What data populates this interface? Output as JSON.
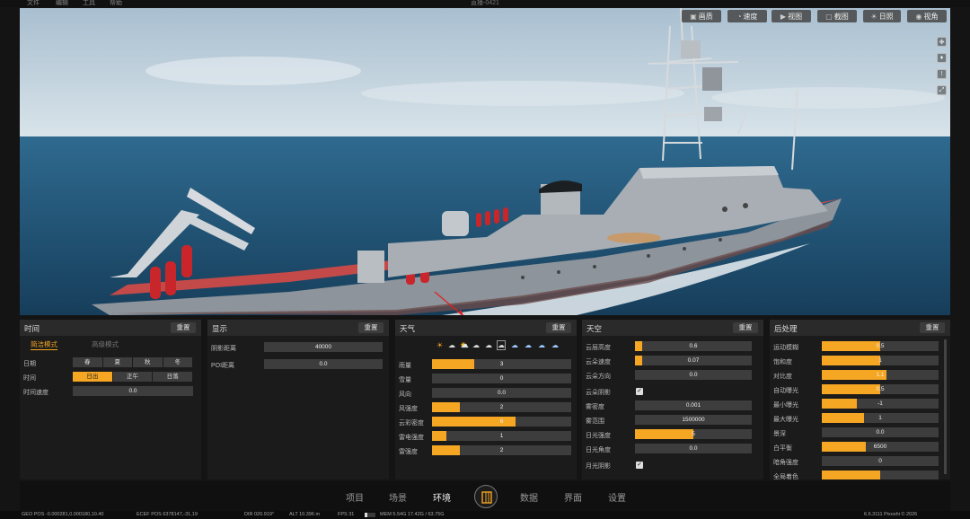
{
  "menubar": {
    "items": [
      "文件",
      "编辑",
      "工具",
      "帮助"
    ],
    "window_title": "直播-0421"
  },
  "viewport": {
    "top_buttons": [
      {
        "icon": "image-icon",
        "label": "画质"
      },
      {
        "icon": "speed-icon",
        "label": "速度"
      },
      {
        "icon": "video-icon",
        "label": "视图"
      },
      {
        "icon": "screenshot-icon",
        "label": "截图"
      },
      {
        "icon": "sun-icon",
        "label": "日照"
      },
      {
        "icon": "eye-icon",
        "label": "视角"
      }
    ],
    "side_icons": [
      "move-icon",
      "walk-icon",
      "info-icon",
      "resize-icon"
    ]
  },
  "panels": {
    "time": {
      "title": "时间",
      "reset": "重置",
      "modes": [
        "简洁模式",
        "高级模式"
      ],
      "rows": [
        {
          "label": "日期",
          "segments": [
            "春",
            "夏",
            "秋",
            "冬"
          ],
          "active": -1
        },
        {
          "label": "时间",
          "segments": [
            "日出",
            "正午",
            "日落"
          ],
          "active": 0
        },
        {
          "label": "时间速度",
          "value": "0.0",
          "fill": 0
        }
      ]
    },
    "display": {
      "title": "显示",
      "reset": "重置",
      "rows": [
        {
          "label": "阴影距离",
          "value": "40000",
          "fill": 0
        },
        {
          "label": "POI距离",
          "value": "0.0",
          "fill": 0
        }
      ]
    },
    "weather": {
      "title": "天气",
      "reset": "重置",
      "icons": [
        "☀",
        "☁",
        "⛅",
        "☁",
        "☁",
        "☁",
        "☁",
        "☁",
        "☁",
        "☁"
      ],
      "rows": [
        {
          "label": "雨量",
          "value": "3",
          "fill": 0.3
        },
        {
          "label": "雪量",
          "value": "0",
          "fill": 0
        },
        {
          "label": "风向",
          "value": "0.0",
          "fill": 0
        },
        {
          "label": "风强度",
          "value": "2",
          "fill": 0.2
        },
        {
          "label": "云彩密度",
          "value": "6",
          "fill": 0.6
        },
        {
          "label": "雷电强度",
          "value": "1",
          "fill": 0.1
        },
        {
          "label": "雷强度",
          "value": "2",
          "fill": 0.2
        }
      ]
    },
    "sky": {
      "title": "天空",
      "reset": "重置",
      "rows": [
        {
          "label": "云层高度",
          "value": "0.6",
          "fill": 0.06
        },
        {
          "label": "云朵速度",
          "value": "0.07",
          "fill": 0.06
        },
        {
          "label": "云朵方向",
          "value": "0.0",
          "fill": 0
        },
        {
          "label": "云朵阴影",
          "checkbox": true
        },
        {
          "label": "雾密度",
          "value": "0.001",
          "fill": 0
        },
        {
          "label": "雾范围",
          "value": "1500000",
          "fill": 0
        },
        {
          "label": "日光强度",
          "value": "5",
          "fill": 0.5
        },
        {
          "label": "日光角度",
          "value": "0.0",
          "fill": 0
        },
        {
          "label": "月光阴影",
          "checkbox": true
        }
      ]
    },
    "postprocess": {
      "title": "后处理",
      "reset": "重置",
      "rows": [
        {
          "label": "运动模糊",
          "value": "0.5",
          "fill": 0.5
        },
        {
          "label": "饱和度",
          "value": "1",
          "fill": 0.5
        },
        {
          "label": "对比度",
          "value": "1.1",
          "fill": 0.55
        },
        {
          "label": "自动曝光",
          "value": "0.5",
          "fill": 0.5
        },
        {
          "label": "最小曝光",
          "value": "-1",
          "fill": 0.3
        },
        {
          "label": "最大曝光",
          "value": "1",
          "fill": 0.36
        },
        {
          "label": "景深",
          "value": "0.0",
          "fill": 0
        },
        {
          "label": "白平衡",
          "value": "6500",
          "fill": 0.38
        },
        {
          "label": "暗角强度",
          "value": "0",
          "fill": 0
        },
        {
          "label": "全局着色",
          "value": "",
          "fill": 0.5
        }
      ]
    }
  },
  "bottom_nav": {
    "items": [
      "项目",
      "场景",
      "环境",
      "数据",
      "界面",
      "设置"
    ],
    "active": "环境"
  },
  "status": {
    "geo": "GEO POS  -0.000281,0.000180,10.40",
    "ecef": "ECEF POS  6378147,-31,19",
    "dir": "DIR  020.919°",
    "alt": "ALT  10.396 m",
    "fps": "FPS  31",
    "mem": "MEM  5.54G  17.42G / 63.75G",
    "version": "6.6.3111  Pixoshi © 2026",
    "mem_fill": 0.28
  },
  "colors": {
    "accent": "#f5a623",
    "panel": "#1b1b1b",
    "panel_head": "#2a2a2a",
    "sea": "#1f4f72",
    "hull": "#8d949b",
    "deck": "#c44a4a"
  }
}
